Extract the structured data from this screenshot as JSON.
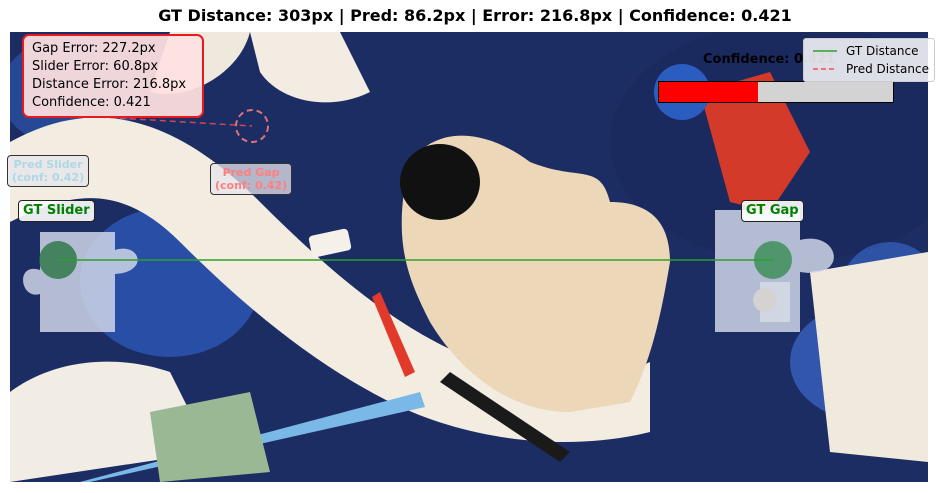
{
  "title": "GT Distance: 303px | Pred: 86.2px | Error: 216.8px | Confidence: 0.421",
  "metrics": {
    "gap_error": "Gap Error: 227.2px",
    "slider_error": "Slider Error: 60.8px",
    "distance_error": "Distance Error: 216.8px",
    "confidence": "Confidence: 0.421"
  },
  "confidence_label": "Confidence: 0.421",
  "legend": [
    {
      "label": "GT Distance",
      "color": "#2ca02c",
      "style": "solid"
    },
    {
      "label": "Pred Distance",
      "color": "#ff4d4d",
      "style": "dashed"
    }
  ],
  "labels": {
    "gt_slider": "GT Slider",
    "gt_gap": "GT Gap",
    "pred_slider_line1": "Pred Slider",
    "pred_slider_line2": "(conf: 0.42)",
    "pred_gap_line1": "Pred Gap",
    "pred_gap_line2": "(conf: 0.42)"
  },
  "colors": {
    "gt": "#008000",
    "pred_slider": "#add8e6",
    "pred_gap": "#ff7f7f",
    "confidence_fill": "#ff0000",
    "confidence_track": "#d3d3d3",
    "box_border": "#e8191f"
  },
  "chart_data": {
    "type": "scatter",
    "title": "GT Distance: 303px | Pred: 86.2px | Error: 216.8px | Confidence: 0.421",
    "gt_distance_px": 303,
    "pred_distance_px": 86.2,
    "error_px": 216.8,
    "confidence": 0.421,
    "gap_error_px": 227.2,
    "slider_error_px": 60.8,
    "distance_error_px": 216.8,
    "series": [
      {
        "name": "GT Distance",
        "style": "solid"
      },
      {
        "name": "Pred Distance",
        "style": "dashed"
      }
    ],
    "legend_position": "top-right",
    "axes_visible": false
  }
}
